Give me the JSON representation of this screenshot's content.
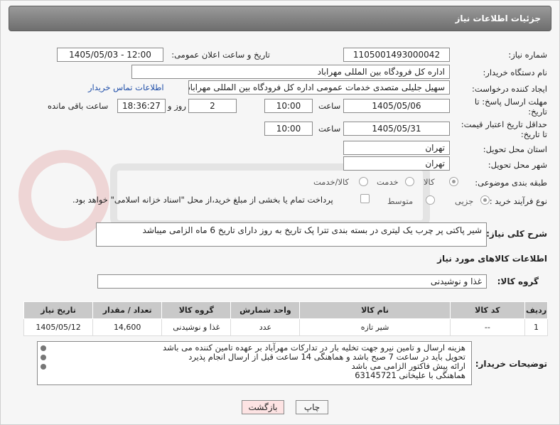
{
  "header": {
    "title": "جزئیات اطلاعات نیاز"
  },
  "fields": {
    "need_number_label": "شماره نیاز:",
    "need_number": "1105001493000042",
    "announce_label": "تاریخ و ساعت اعلان عمومی:",
    "announce_value": "1405/05/03 - 12:00",
    "buyer_org_label": "نام دستگاه خریدار:",
    "buyer_org": "اداره کل فرودگاه بین المللی مهراباد",
    "creator_label": "ایجاد کننده درخواست:",
    "creator": "سهیل جلیلی متصدی خدمات عمومی اداره کل فرودگاه بین المللی مهراباد",
    "contact_link": "اطلاعات تماس خریدار",
    "deadline_label_1": "مهلت ارسال پاسخ: تا",
    "deadline_label_2": "تاریخ:",
    "deadline_date": "1405/05/06",
    "time_label": "ساعت",
    "deadline_time": "10:00",
    "days_value": "2",
    "days_label": "روز و",
    "remaining_time": "18:36:27",
    "remaining_label": "ساعت باقی مانده",
    "validity_label_1": "حداقل تاریخ اعتبار قیمت:",
    "validity_label_2": "تا تاریخ:",
    "validity_date": "1405/05/31",
    "validity_time": "10:00",
    "province_label": "استان محل تحویل:",
    "province": "تهران",
    "city_label": "شهر محل تحویل:",
    "city": "تهران",
    "category_label": "طبقه بندی موضوعی:",
    "category_options": [
      "کالا",
      "خدمت",
      "کالا/خدمت"
    ],
    "process_label": "نوع فرآیند خرید :",
    "process_options": [
      "جزیی",
      "متوسط"
    ],
    "payment_note": "پرداخت تمام یا بخشی از مبلغ خرید،از محل \"اسناد خزانه اسلامی\" خواهد بود."
  },
  "description": {
    "label": "شرح کلی نیاز:",
    "text": "شیر پاکتی پر چرب یک لیتری در بسته بندی تترا پک تاریخ به روز دارای تاریخ 6 ماه الزامی میباشد"
  },
  "goods": {
    "section_title": "اطلاعات کالاهای مورد نیاز",
    "group_label": "گروه کالا:",
    "group_value": "غذا و نوشیدنی"
  },
  "table": {
    "headers": [
      "ردیف",
      "کد کالا",
      "نام کالا",
      "واحد شمارش",
      "گروه کالا",
      "تعداد / مقدار",
      "تاریخ نیاز"
    ],
    "rows": [
      [
        "1",
        "--",
        "شیر تازه",
        "عدد",
        "غذا و نوشیدنی",
        "14,600",
        "1405/05/12"
      ]
    ]
  },
  "notes": {
    "label": "توضیحات خریدار:",
    "lines": [
      "هزینه ارسال و تامین نیرو جهت تخلیه بار در تدارکات مهرآباد بر عهده تامین کننده می باشد",
      "تحویل باید در ساعت 7 صبح باشد و هماهنگی 14 ساعت قبل از ارسال انجام پذیرد",
      "ارائه پیش فاکتور الزامی می باشد",
      "هماهنگی با علیخانی 63145721"
    ]
  },
  "buttons": {
    "print": "چاپ",
    "back": "بازگشت"
  },
  "colors": {
    "header_bg": "#7d7d7d",
    "link": "#1f4ea8",
    "back_button_bg": "#fde3e3"
  }
}
